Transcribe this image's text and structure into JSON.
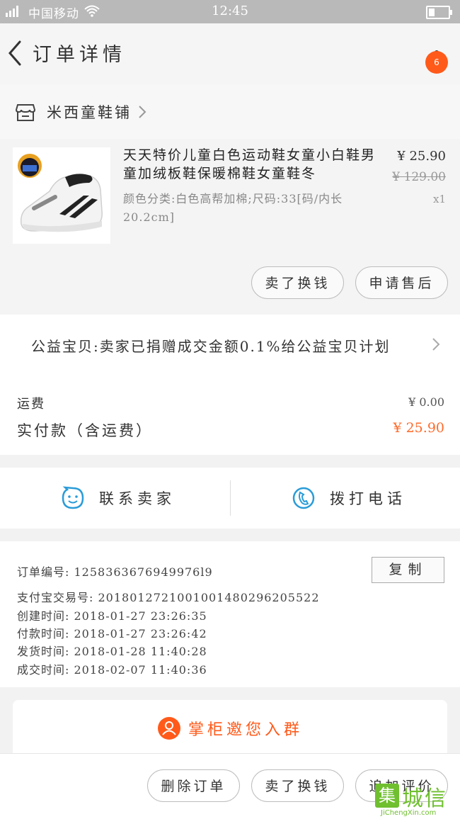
{
  "status_bar": {
    "signal": "4G",
    "carrier": "中国移动",
    "time": "12:45"
  },
  "header": {
    "title": "订单详情",
    "badge_count": "6"
  },
  "store": {
    "name": "米西童鞋铺"
  },
  "product": {
    "title": "天天特价儿童白色运动鞋女童小白鞋男童加绒板鞋保暖棉鞋女童鞋冬",
    "spec": "颜色分类:白色高帮加棉;尺码:33[码/内长20.2cm]",
    "price": "¥ 25.90",
    "original_price": "¥ 129.00",
    "quantity": "x1",
    "buttons": {
      "buy_again": "卖了换钱",
      "after_sale": "申请售后"
    }
  },
  "charity": {
    "text": "公益宝贝:卖家已捐赠成交金额0.1%给公益宝贝计划"
  },
  "fees": {
    "shipping_label": "运费",
    "shipping_value": "¥ 0.00",
    "paid_label": "实付款（含运费）",
    "paid_value": "¥ 25.90"
  },
  "contact": {
    "seller_label": "联系卖家",
    "phone_label": "拨打电话"
  },
  "order_info": {
    "order_no": "订单编号:  1258363676949976l9",
    "alipay_no": "支付宝交易号:  2018012721001001480296205522",
    "created": "创建时间:   2018-01-27  23:26:35",
    "paid": "付款时间:   2018-01-27  23:26:42",
    "shipped": "发货时间:   2018-01-28  11:40:28",
    "completed": "成交时间:   2018-02-07  11:40:36",
    "copy_label": "复制"
  },
  "invite": {
    "text": "掌柜邀您入群"
  },
  "bottom_bar": {
    "delete_label": "删除订单",
    "sell_label": "卖了换钱",
    "review_label": "追加评价"
  },
  "watermark": {
    "logo_text": "城信",
    "url": "JiChengXin.com"
  }
}
